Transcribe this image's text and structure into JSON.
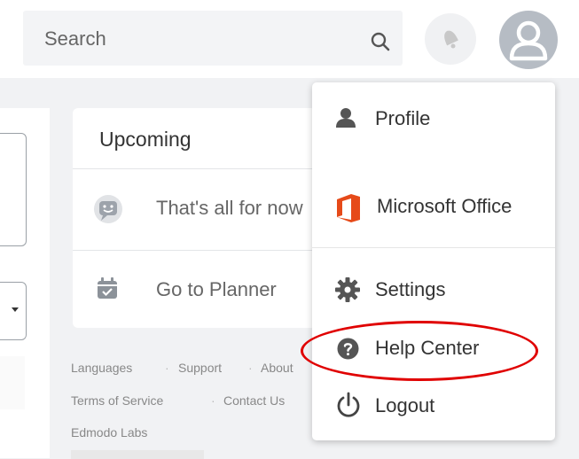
{
  "header": {
    "search_placeholder": "Search",
    "icons": [
      "search-icon",
      "notification-bell-icon",
      "user-avatar-icon"
    ]
  },
  "upcoming": {
    "title": "Upcoming",
    "empty_text": "That's all for now",
    "planner_link": "Go to Planner"
  },
  "footer": {
    "links": [
      "Languages",
      "Support",
      "About",
      "Terms of Service",
      "Contact Us",
      "Edmodo Labs"
    ]
  },
  "menu": {
    "items": [
      {
        "label": "Profile",
        "icon": "person-icon"
      },
      {
        "label": "Microsoft Office",
        "icon": "microsoft-office-icon"
      },
      {
        "label": "Settings",
        "icon": "gear-icon"
      },
      {
        "label": "Help Center",
        "icon": "help-circle-icon"
      },
      {
        "label": "Logout",
        "icon": "power-icon"
      }
    ]
  },
  "colors": {
    "office_orange": "#e64a19",
    "highlight_oval": "#e00000",
    "icon_gray": "#555555"
  }
}
